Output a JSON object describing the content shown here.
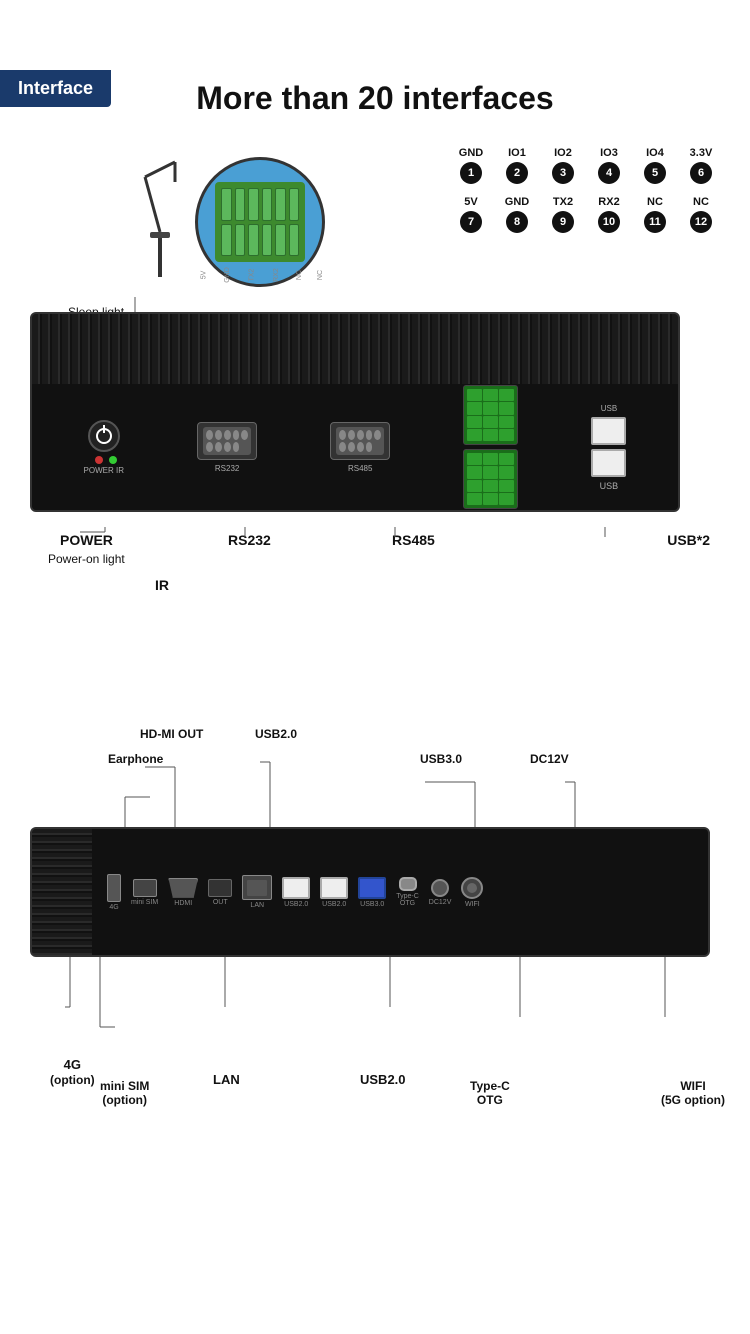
{
  "header": {
    "badge_label": "Interface",
    "badge_bg": "#1a3a6b"
  },
  "title": "More than 20 interfaces",
  "gpio": {
    "row1": [
      {
        "label": "GND",
        "num": "1"
      },
      {
        "label": "IO1",
        "num": "2"
      },
      {
        "label": "IO2",
        "num": "3"
      },
      {
        "label": "IO3",
        "num": "4"
      },
      {
        "label": "IO4",
        "num": "5"
      },
      {
        "label": "3.3V",
        "num": "6"
      }
    ],
    "row2": [
      {
        "label": "5V",
        "num": "7"
      },
      {
        "label": "GND",
        "num": "8"
      },
      {
        "label": "TX2",
        "num": "9"
      },
      {
        "label": "RX2",
        "num": "10"
      },
      {
        "label": "NC",
        "num": "11"
      },
      {
        "label": "NC",
        "num": "12"
      }
    ]
  },
  "top_device": {
    "labels": {
      "sleep_light": "Sleep light",
      "power": "POWER",
      "power_on_light": "Power-on light",
      "ir": "IR",
      "rs232": "RS232",
      "rs485": "RS485",
      "usb2": "USB*2"
    },
    "port_labels": {
      "power": "POWER  IR",
      "rs232": "RS232",
      "rs485": "RS485",
      "usb": "USB"
    }
  },
  "bottom_device": {
    "labels": {
      "hdmi": "HD-MI OUT",
      "usb20_top": "USB2.0",
      "earphone": "Earphone",
      "usb30": "USB3.0",
      "dc12v": "DC12V",
      "fg4": "4G\n(option)",
      "mini_sim": "mini SIM\n(option)",
      "lan": "LAN",
      "usb20": "USB2.0",
      "typec": "Type-C\nOTG",
      "wifi": "WIFI\n(5G option)"
    },
    "port_row_labels": [
      "4G",
      "mini SIM",
      "HDMI",
      "OUT",
      "LAN",
      "USB2.0",
      "USB2.0",
      "USB3.0",
      "Type-C\nOTG",
      "DC12V",
      "WIFI"
    ]
  }
}
